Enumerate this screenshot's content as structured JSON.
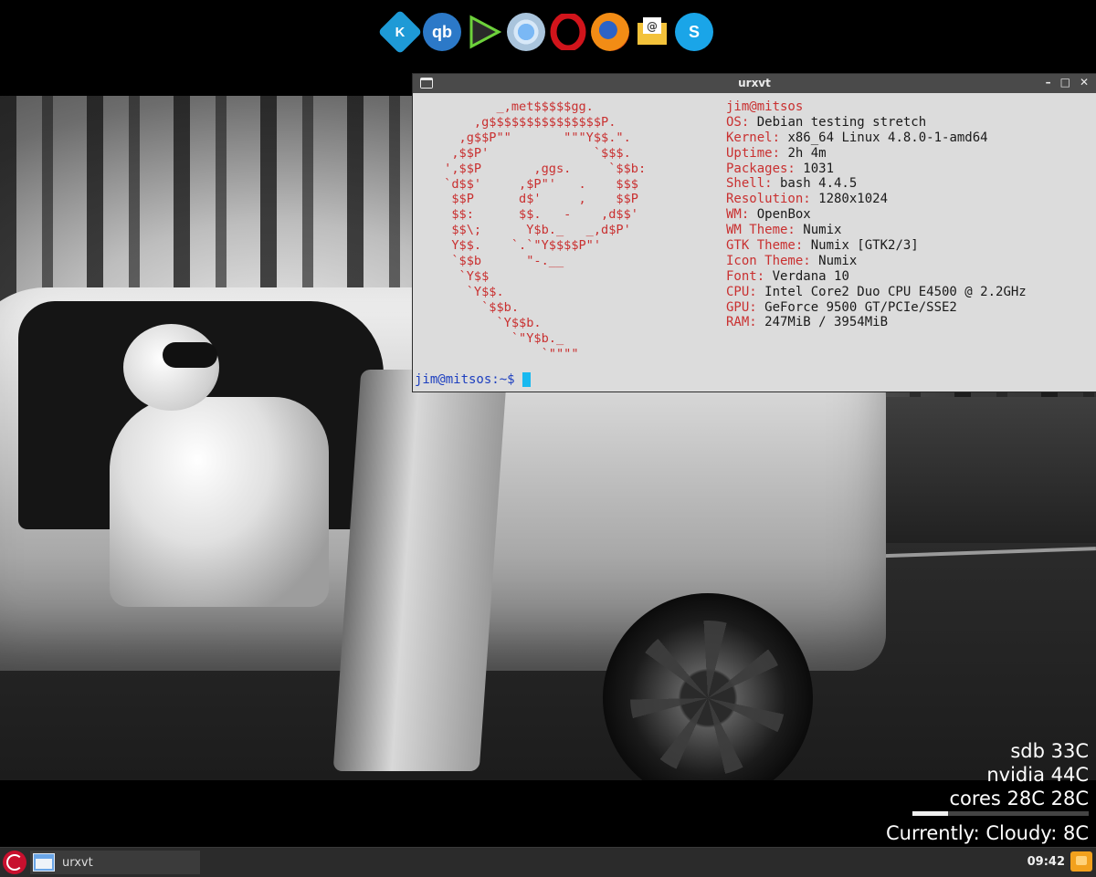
{
  "dock": {
    "icons": [
      {
        "name": "kodi-icon",
        "glyph": "K"
      },
      {
        "name": "qbittorrent-icon",
        "glyph": "qb"
      },
      {
        "name": "media-player-icon",
        "glyph": "▶"
      },
      {
        "name": "chromium-icon",
        "glyph": ""
      },
      {
        "name": "opera-icon",
        "glyph": "O"
      },
      {
        "name": "firefox-icon",
        "glyph": ""
      },
      {
        "name": "mail-icon",
        "glyph": "@"
      },
      {
        "name": "skype-icon",
        "glyph": "S"
      }
    ]
  },
  "terminal": {
    "title": "urxvt",
    "controls": {
      "minimize": "–",
      "maximize": "□",
      "close": "✕"
    },
    "ascii_art": "        _,met$$$$$gg.\n     ,g$$$$$$$$$$$$$$$P.\n   ,g$$P\"\"       \"\"\"Y$$.\".\n  ,$$P'              `$$$.\n ',$$P       ,ggs.     `$$b:\n `d$$'     ,$P\"'   .    $$$\n  $$P      d$'     ,    $$P\n  $$:      $$.   -    ,d$$'\n  $$\\;      Y$b._   _,d$P'\n  Y$$.    `.`\"Y$$$$P\"'\n  `$$b      \"-.__\n   `Y$$\n    `Y$$.\n      `$$b.\n        `Y$$b.\n          `\"Y$b._\n              `\"\"\"\"",
    "user_host": "jim@mitsos",
    "info": [
      {
        "key": "OS:",
        "value": " Debian testing stretch"
      },
      {
        "key": "Kernel:",
        "value": " x86_64 Linux 4.8.0-1-amd64"
      },
      {
        "key": "Uptime:",
        "value": " 2h 4m"
      },
      {
        "key": "Packages:",
        "value": " 1031"
      },
      {
        "key": "Shell:",
        "value": " bash 4.4.5"
      },
      {
        "key": "Resolution:",
        "value": " 1280x1024"
      },
      {
        "key": "WM:",
        "value": " OpenBox"
      },
      {
        "key": "WM Theme:",
        "value": " Numix"
      },
      {
        "key": "GTK Theme:",
        "value": " Numix [GTK2/3]"
      },
      {
        "key": "Icon Theme:",
        "value": " Numix"
      },
      {
        "key": "Font:",
        "value": " Verdana 10"
      },
      {
        "key": "CPU:",
        "value": " Intel Core2 Duo CPU E4500 @ 2.2GHz"
      },
      {
        "key": "GPU:",
        "value": " GeForce 9500 GT/PCIe/SSE2"
      },
      {
        "key": "RAM:",
        "value": " 247MiB / 3954MiB"
      }
    ],
    "prompt": "jim@mitsos:~$"
  },
  "conky": {
    "lines": [
      "sdb 33C",
      "nvidia 44C",
      "cores 28C 28C"
    ],
    "bar_fraction": 0.2,
    "weather": "Currently: Cloudy: 8C"
  },
  "taskbar": {
    "task_label": "urxvt",
    "clock": "09:42"
  },
  "colors": {
    "terminal_accent": "#c93030",
    "prompt": "#1d3fbf",
    "cursor": "#18b9f0",
    "taskbar": "#2b2b2b"
  }
}
